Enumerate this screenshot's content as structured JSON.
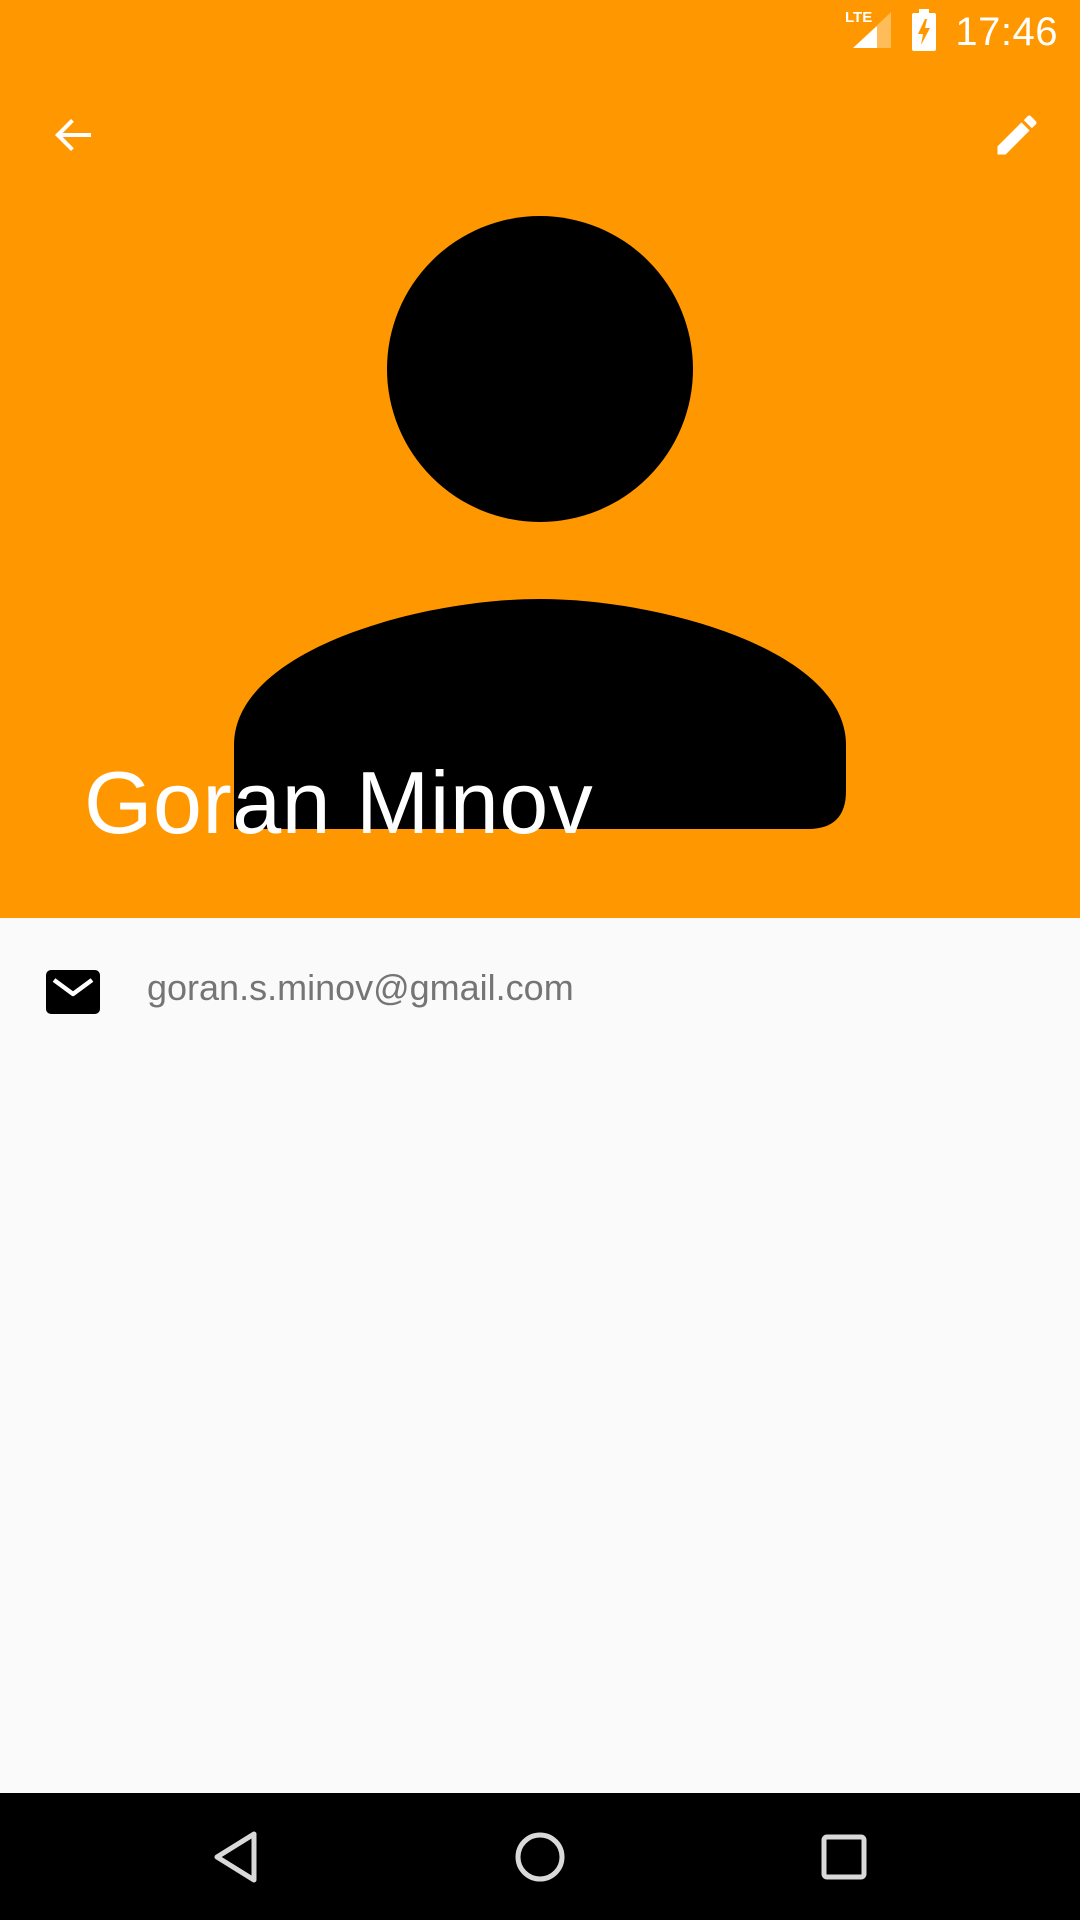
{
  "status_bar": {
    "time": "17:46",
    "network_label": "LTE",
    "icons": [
      "lte-signal-icon",
      "battery-charging-icon"
    ]
  },
  "toolbar": {
    "back_icon": "arrow-back-icon",
    "edit_icon": "pencil-edit-icon"
  },
  "contact": {
    "name": "Goran Minov",
    "avatar_icon": "person-placeholder-icon",
    "email": "goran.s.minov@gmail.com",
    "email_icon": "mail-icon"
  },
  "nav_bar": {
    "icons": [
      "nav-back-icon",
      "nav-home-icon",
      "nav-recents-icon"
    ]
  },
  "colors": {
    "header_background": "#ff9800",
    "page_background": "#fafafa",
    "header_text": "#ffffff",
    "secondary_text": "#757575",
    "nav_background": "#000000"
  }
}
